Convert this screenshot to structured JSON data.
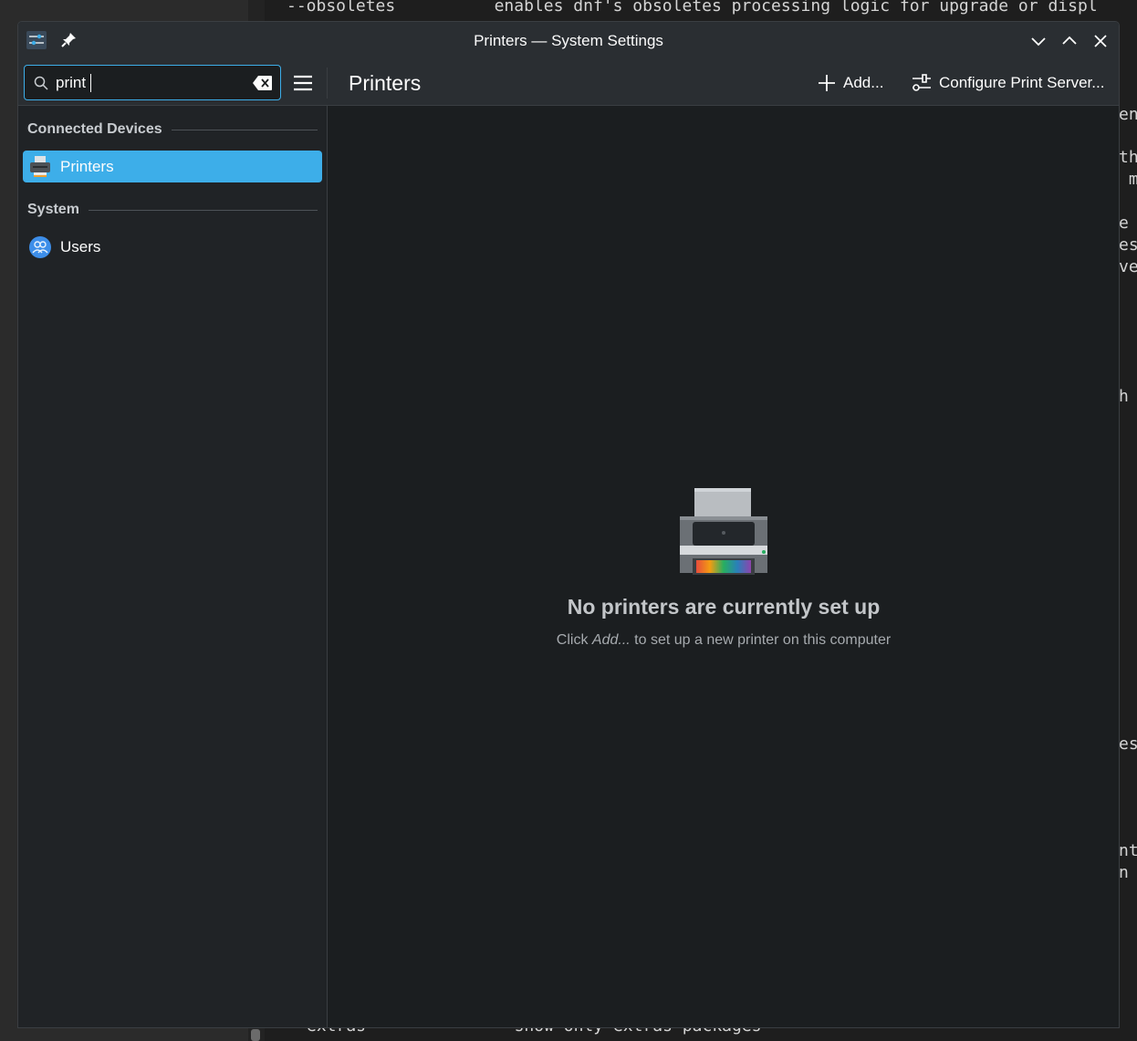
{
  "terminal": {
    "lines": [
      {
        "text": "--obsoletes          enables dnf's obsoletes processing logic for upgrade or displ"
      },
      {
        "text": "extras               show only extras packages"
      },
      {
        "text": "en"
      },
      {
        "text": "th"
      },
      {
        "text": " m"
      },
      {
        "text": "e "
      },
      {
        "text": "es"
      },
      {
        "text": "ve"
      },
      {
        "text": "h "
      },
      {
        "text": "es"
      },
      {
        "text": "nt"
      },
      {
        "text": "n "
      }
    ]
  },
  "window": {
    "title": "Printers — System Settings",
    "app_icon": "system-settings-icon",
    "buttons": [
      "minimize",
      "maximize",
      "close"
    ]
  },
  "toolbar": {
    "search_value": "print",
    "page_title": "Printers",
    "add_label": "Add...",
    "configure_label": "Configure Print Server..."
  },
  "sidebar": {
    "sections": [
      {
        "title": "Connected Devices",
        "items": [
          {
            "label": "Printers",
            "icon": "printer-icon",
            "selected": true
          }
        ]
      },
      {
        "title": "System",
        "items": [
          {
            "label": "Users",
            "icon": "users-icon",
            "selected": false
          }
        ]
      }
    ]
  },
  "main": {
    "empty_title": "No printers are currently set up",
    "empty_hint_prefix": "Click ",
    "empty_hint_em": "Add...",
    "empty_hint_suffix": " to set up a new printer on this computer"
  },
  "colors": {
    "accent": "#3daee9",
    "window_bg": "#1b1e20",
    "header_bg": "#2a2e32"
  }
}
